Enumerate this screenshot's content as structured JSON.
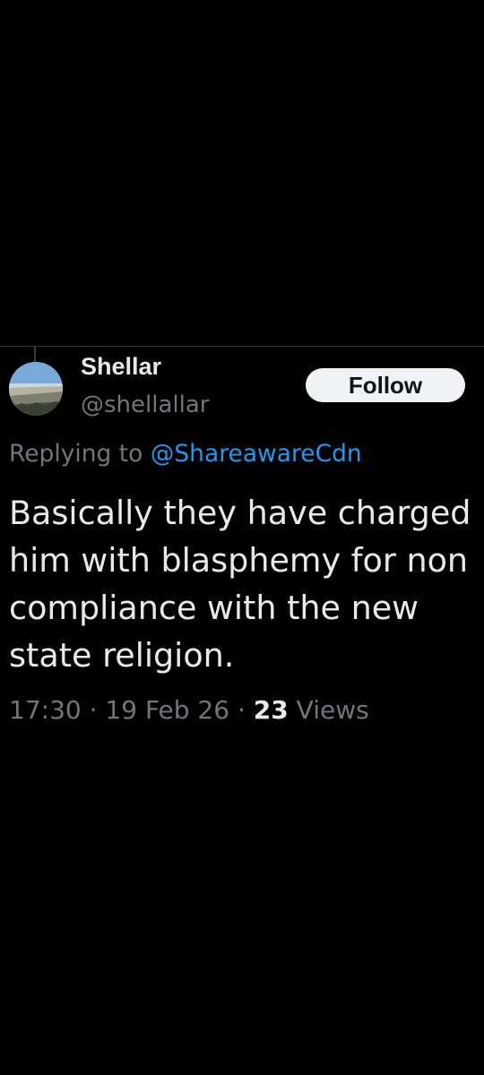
{
  "tweet": {
    "author": {
      "display_name": "Shellar",
      "handle": "@shellallar",
      "avatar_icon": "beach-landscape-avatar"
    },
    "follow_label": "Follow",
    "replying_prefix": "Replying to",
    "replying_to": "@ShareawareCdn",
    "text_lines": [
      "Basically they have charged",
      "him with blasphemy for non",
      "compliance with the new",
      "state religion."
    ],
    "meta": {
      "time": "17:30",
      "separator": "·",
      "date": "19 Feb 26",
      "views_count": "23",
      "views_label": "Views"
    }
  },
  "colors": {
    "background": "#000000",
    "text_primary": "#e7e9ea",
    "text_secondary": "#71767b",
    "link": "#1d9bf0",
    "button_bg": "#eff3f4",
    "button_text": "#0f1419",
    "divider": "#2f3336"
  }
}
